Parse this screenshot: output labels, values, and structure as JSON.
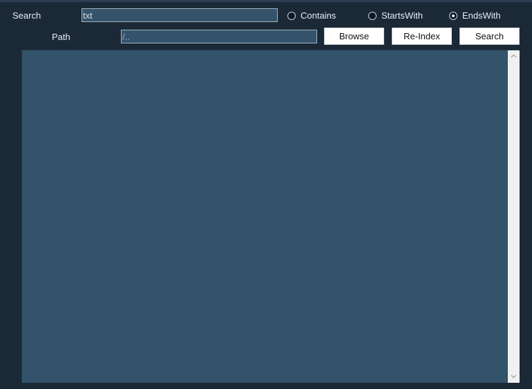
{
  "search": {
    "label": "Search",
    "value": "txt"
  },
  "match_mode": {
    "options": [
      {
        "label": "Contains",
        "checked": false
      },
      {
        "label": "StartsWith",
        "checked": false
      },
      {
        "label": "EndsWith",
        "checked": true
      }
    ]
  },
  "path": {
    "label": "Path",
    "placeholder": "/.."
  },
  "buttons": {
    "browse": "Browse",
    "reindex": "Re-Index",
    "search": "Search"
  },
  "icons": {
    "scroll_up": "chevron-up-icon",
    "scroll_down": "chevron-down-icon"
  },
  "colors": {
    "background": "#1b2836",
    "panel": "#33536a",
    "input": "#34536a"
  }
}
